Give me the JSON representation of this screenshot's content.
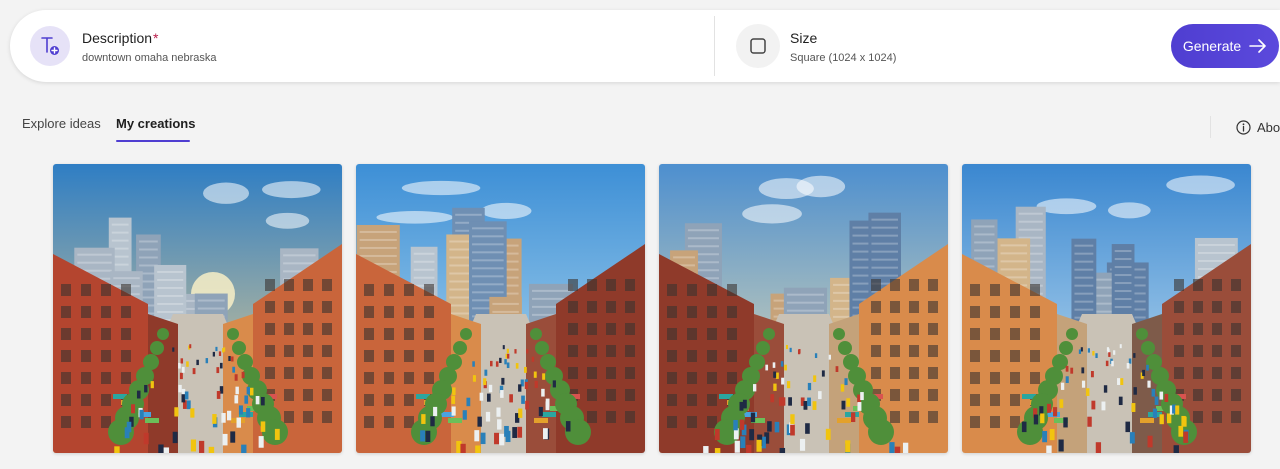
{
  "prompt": {
    "description_label": "Description",
    "required_mark": "*",
    "description_value": "downtown omaha nebraska",
    "size_label": "Size",
    "size_value": "Square (1024 x 1024)",
    "generate_label": "Generate"
  },
  "tabs": {
    "explore": "Explore ideas",
    "creations": "My creations",
    "about": "Abo"
  },
  "colors": {
    "accent": "#4f3ed1",
    "icon_bg": "#e6e2f7"
  },
  "images": [
    {
      "name": "creation-1",
      "sky_top": "#2f7ec4",
      "sky_bottom": "#f5d28a",
      "sun": true
    },
    {
      "name": "creation-2",
      "sky_top": "#3d8fd6",
      "sky_bottom": "#bfe2f2",
      "sun": false
    },
    {
      "name": "creation-3",
      "sky_top": "#4d8fcf",
      "sky_bottom": "#f4e3b0",
      "sun": false
    },
    {
      "name": "creation-4",
      "sky_top": "#3a87d0",
      "sky_bottom": "#cfe8f5",
      "sun": false
    }
  ]
}
